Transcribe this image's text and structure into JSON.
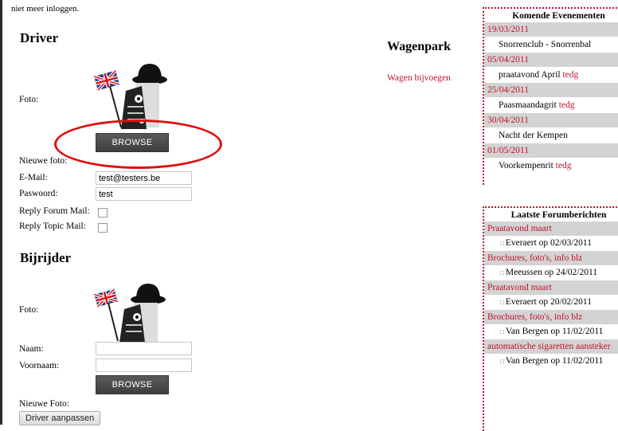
{
  "top_note": "niet meer inloggen.",
  "driver": {
    "heading": "Driver",
    "foto_label": "Foto:",
    "browse_label": "BROWSE",
    "nieuwe_foto_label": "Nieuwe foto:",
    "email_label": "E-Mail:",
    "email_value": "test@testers.be",
    "password_label": "Paswoord:",
    "password_value": "test",
    "reply_forum_label": "Reply Forum Mail:",
    "reply_topic_label": "Reply Topic Mail:"
  },
  "bijrijder": {
    "heading": "Bijrijder",
    "foto_label": "Foto:",
    "naam_label": "Naam:",
    "voornaam_label": "Voornaam:",
    "browse_label": "BROWSE",
    "nieuwe_foto_label": "Nieuwe Foto:",
    "submit_label": "Driver aanpassen"
  },
  "wagenpark": {
    "title": "Wagenpark",
    "add_link": "Wagen bijvoegen"
  },
  "events": {
    "title": "Komende Evenementen",
    "items": [
      {
        "date": "19/03/2011",
        "name": "Snorrenclub - Snorrenbal",
        "tag": ""
      },
      {
        "date": "05/04/2011",
        "name": "praatavond April",
        "tag": "tedg"
      },
      {
        "date": "25/04/2011",
        "name": "Paasmaandagrit",
        "tag": "tedg"
      },
      {
        "date": "30/04/2011",
        "name": "Nacht der Kempen",
        "tag": ""
      },
      {
        "date": "01/05/2011",
        "name": "Voorkempenrit",
        "tag": "tedg"
      }
    ]
  },
  "forum": {
    "title": "Laatste Forumberichten",
    "items": [
      {
        "topic": "Praatavond maart",
        "post": "Everaert op 02/03/2011"
      },
      {
        "topic": "Brochures, foto's, info blz",
        "post": "Meeussen op 24/02/2011"
      },
      {
        "topic": "Praatavond maart",
        "post": "Everaert op 20/02/2011"
      },
      {
        "topic": "Brochures, foto's, info blz",
        "post": "Van Bergen op 11/02/2011"
      },
      {
        "topic": "automatische sigaretten aansteker",
        "post": "Van Bergen op 11/02/2011"
      }
    ]
  }
}
